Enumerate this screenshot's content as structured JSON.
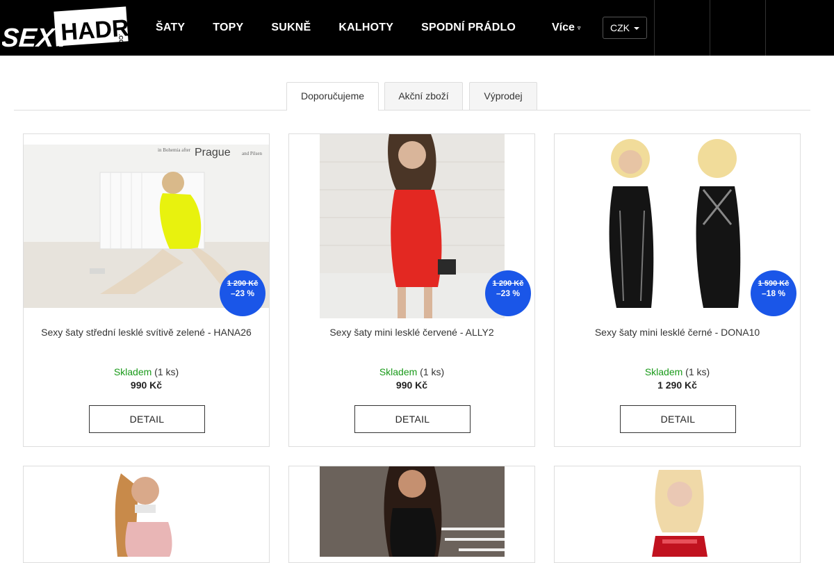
{
  "logo": {
    "text": "SEXY HADRY",
    "suffix": ".COM"
  },
  "nav": {
    "items": [
      "ŠATY",
      "TOPY",
      "SUKNĚ",
      "KALHOTY",
      "SPODNÍ PRÁDLO"
    ],
    "more_label": "Více",
    "currency": "CZK"
  },
  "tabs": [
    "Doporučujeme",
    "Akční zboží",
    "Výprodej"
  ],
  "products": [
    {
      "title": "Sexy šaty střední lesklé svítivě zelené - HANA26",
      "stock_label": "Skladem",
      "stock_count": "(1 ks)",
      "price": "990 Kč",
      "old_price": "1 290 Kč",
      "discount": "–23 %",
      "button": "DETAIL"
    },
    {
      "title": "Sexy šaty mini lesklé červené - ALLY2",
      "stock_label": "Skladem",
      "stock_count": "(1 ks)",
      "price": "990 Kč",
      "old_price": "1 290 Kč",
      "discount": "–23 %",
      "button": "DETAIL"
    },
    {
      "title": "Sexy šaty mini lesklé černé - DONA10",
      "stock_label": "Skladem",
      "stock_count": "(1 ks)",
      "price": "1 290 Kč",
      "old_price": "1 590 Kč",
      "discount": "–18 %",
      "button": "DETAIL"
    }
  ],
  "photo_text": {
    "prague": "Prague",
    "prefix": "in Bohemia after",
    "suffix": "and Pilsen"
  },
  "colors": {
    "badge": "#1a56e8",
    "in_stock": "#1a9a1a",
    "header_bg": "#000000"
  }
}
